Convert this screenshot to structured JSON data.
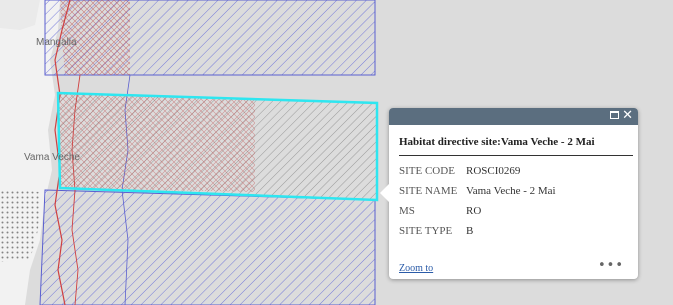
{
  "map": {
    "place_labels": [
      "Mangalia",
      "Vama Veche"
    ]
  },
  "popup": {
    "title": "Habitat directive site:Vama Veche - 2 Mai",
    "attributes": [
      {
        "key": "SITE CODE",
        "value": "ROSCI0269"
      },
      {
        "key": "SITE NAME",
        "value": "Vama Veche - 2 Mai"
      },
      {
        "key": "MS",
        "value": "RO"
      },
      {
        "key": "SITE TYPE",
        "value": "B"
      }
    ],
    "zoom_label": "Zoom to",
    "more_label": "•••",
    "maximize_icon": "maximize-icon",
    "close_icon": "close-icon",
    "close_glyph": "✕"
  },
  "colors": {
    "sea": "#dcdcdc",
    "land": "#f2f2f2",
    "hatch_blue": "#5a5fcf",
    "hatch_red": "#cc4a4a",
    "selection": "#2ee6f0",
    "popup_header": "#5b6e7f"
  }
}
